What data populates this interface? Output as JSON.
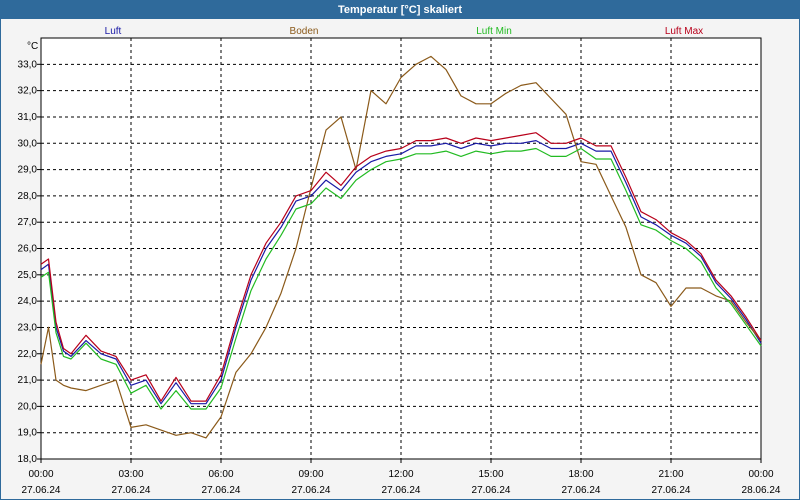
{
  "window": {
    "title": "Temperatur [°C] skaliert"
  },
  "colors": {
    "titlebar": "#2f6a9b",
    "grid": "#000000",
    "background": "#f4f4f4"
  },
  "chart_data": {
    "type": "line",
    "title": "Temperatur [°C] skaliert",
    "ylabel": "°C",
    "ylim": [
      18.0,
      34.0
    ],
    "xlim": [
      0,
      24
    ],
    "grid": true,
    "legend_position": "top",
    "y_ticks": [
      "18,0",
      "19,0",
      "20,0",
      "21,0",
      "22,0",
      "23,0",
      "24,0",
      "25,0",
      "26,0",
      "27,0",
      "28,0",
      "29,0",
      "30,0",
      "31,0",
      "32,0",
      "33,0"
    ],
    "x_ticks": [
      {
        "time": "00:00",
        "date": "27.06.24"
      },
      {
        "time": "03:00",
        "date": "27.06.24"
      },
      {
        "time": "06:00",
        "date": "27.06.24"
      },
      {
        "time": "09:00",
        "date": "27.06.24"
      },
      {
        "time": "12:00",
        "date": "27.06.24"
      },
      {
        "time": "15:00",
        "date": "27.06.24"
      },
      {
        "time": "18:00",
        "date": "27.06.24"
      },
      {
        "time": "21:00",
        "date": "27.06.24"
      },
      {
        "time": "00:00",
        "date": "28.06.24"
      }
    ],
    "series": [
      {
        "name": "Luft",
        "color": "#1a1aa6",
        "x": [
          0,
          0.25,
          0.5,
          0.75,
          1,
          1.5,
          2,
          2.5,
          3,
          3.5,
          4,
          4.5,
          5,
          5.5,
          6,
          6.5,
          7,
          7.5,
          8,
          8.5,
          9,
          9.5,
          10,
          10.5,
          11,
          11.5,
          12,
          12.5,
          13,
          13.5,
          14,
          14.5,
          15,
          15.5,
          16,
          16.5,
          17,
          17.5,
          18,
          18.5,
          19,
          19.5,
          20,
          20.5,
          21,
          21.5,
          22,
          22.5,
          23,
          23.5,
          24
        ],
        "values": [
          25.2,
          25.4,
          23.0,
          22.1,
          21.9,
          22.5,
          22.0,
          21.8,
          20.8,
          21.0,
          20.1,
          20.9,
          20.1,
          20.1,
          21.0,
          23.0,
          24.8,
          26.0,
          26.8,
          27.8,
          28.0,
          28.6,
          28.2,
          28.9,
          29.3,
          29.5,
          29.6,
          29.9,
          29.9,
          30.0,
          29.8,
          30.0,
          29.9,
          30.0,
          30.0,
          30.1,
          29.8,
          29.8,
          30.0,
          29.7,
          29.7,
          28.5,
          27.2,
          26.9,
          26.5,
          26.2,
          25.7,
          24.7,
          24.1,
          23.3,
          22.4
        ]
      },
      {
        "name": "Boden",
        "color": "#8b5a1a",
        "x": [
          0,
          0.25,
          0.5,
          0.75,
          1,
          1.5,
          2,
          2.5,
          3,
          3.5,
          4,
          4.5,
          5,
          5.5,
          6,
          6.5,
          7,
          7.5,
          8,
          8.5,
          9,
          9.5,
          10,
          10.5,
          11,
          11.5,
          12,
          12.5,
          13,
          13.5,
          14,
          14.5,
          15,
          15.5,
          16,
          16.5,
          17,
          17.5,
          18,
          18.5,
          19,
          19.5,
          20,
          20.5,
          21,
          21.5,
          22,
          22.5,
          23,
          23.5,
          24
        ],
        "values": [
          21.6,
          23.0,
          21.0,
          20.8,
          20.7,
          20.6,
          20.8,
          21.0,
          19.2,
          19.3,
          19.1,
          18.9,
          19.0,
          18.8,
          19.6,
          21.3,
          22.0,
          23.0,
          24.3,
          26.0,
          28.3,
          30.5,
          31.0,
          29.0,
          32.0,
          31.5,
          32.5,
          33.0,
          33.3,
          32.8,
          31.8,
          31.5,
          31.5,
          31.9,
          32.2,
          32.3,
          31.7,
          31.1,
          29.3,
          29.2,
          28.0,
          26.8,
          25.0,
          24.7,
          23.8,
          24.5,
          24.5,
          24.2,
          24.0,
          23.2,
          22.5
        ]
      },
      {
        "name": "Luft Min",
        "color": "#22bb22",
        "x": [
          0,
          0.25,
          0.5,
          0.75,
          1,
          1.5,
          2,
          2.5,
          3,
          3.5,
          4,
          4.5,
          5,
          5.5,
          6,
          6.5,
          7,
          7.5,
          8,
          8.5,
          9,
          9.5,
          10,
          10.5,
          11,
          11.5,
          12,
          12.5,
          13,
          13.5,
          14,
          14.5,
          15,
          15.5,
          16,
          16.5,
          17,
          17.5,
          18,
          18.5,
          19,
          19.5,
          20,
          20.5,
          21,
          21.5,
          22,
          22.5,
          23,
          23.5,
          24
        ],
        "values": [
          24.9,
          25.1,
          22.8,
          21.9,
          21.8,
          22.4,
          21.8,
          21.6,
          20.5,
          20.8,
          19.9,
          20.6,
          19.9,
          19.9,
          20.7,
          22.6,
          24.4,
          25.6,
          26.5,
          27.5,
          27.7,
          28.3,
          27.9,
          28.6,
          29.0,
          29.3,
          29.4,
          29.6,
          29.6,
          29.7,
          29.5,
          29.7,
          29.6,
          29.7,
          29.7,
          29.8,
          29.5,
          29.5,
          29.8,
          29.4,
          29.4,
          28.2,
          26.9,
          26.7,
          26.3,
          26.0,
          25.5,
          24.5,
          23.9,
          23.1,
          22.3
        ]
      },
      {
        "name": "Luft Max",
        "color": "#b8001a",
        "x": [
          0,
          0.25,
          0.5,
          0.75,
          1,
          1.5,
          2,
          2.5,
          3,
          3.5,
          4,
          4.5,
          5,
          5.5,
          6,
          6.5,
          7,
          7.5,
          8,
          8.5,
          9,
          9.5,
          10,
          10.5,
          11,
          11.5,
          12,
          12.5,
          13,
          13.5,
          14,
          14.5,
          15,
          15.5,
          16,
          16.5,
          17,
          17.5,
          18,
          18.5,
          19,
          19.5,
          20,
          20.5,
          21,
          21.5,
          22,
          22.5,
          23,
          23.5,
          24
        ],
        "values": [
          25.4,
          25.6,
          23.2,
          22.2,
          22.0,
          22.7,
          22.1,
          21.9,
          21.0,
          21.2,
          20.2,
          21.1,
          20.2,
          20.2,
          21.2,
          23.2,
          25.0,
          26.2,
          27.0,
          28.0,
          28.2,
          28.9,
          28.4,
          29.1,
          29.5,
          29.7,
          29.8,
          30.1,
          30.1,
          30.2,
          30.0,
          30.2,
          30.1,
          30.2,
          30.3,
          30.4,
          30.0,
          30.0,
          30.2,
          29.9,
          29.9,
          28.7,
          27.4,
          27.1,
          26.6,
          26.3,
          25.8,
          24.8,
          24.2,
          23.4,
          22.5
        ]
      }
    ]
  }
}
